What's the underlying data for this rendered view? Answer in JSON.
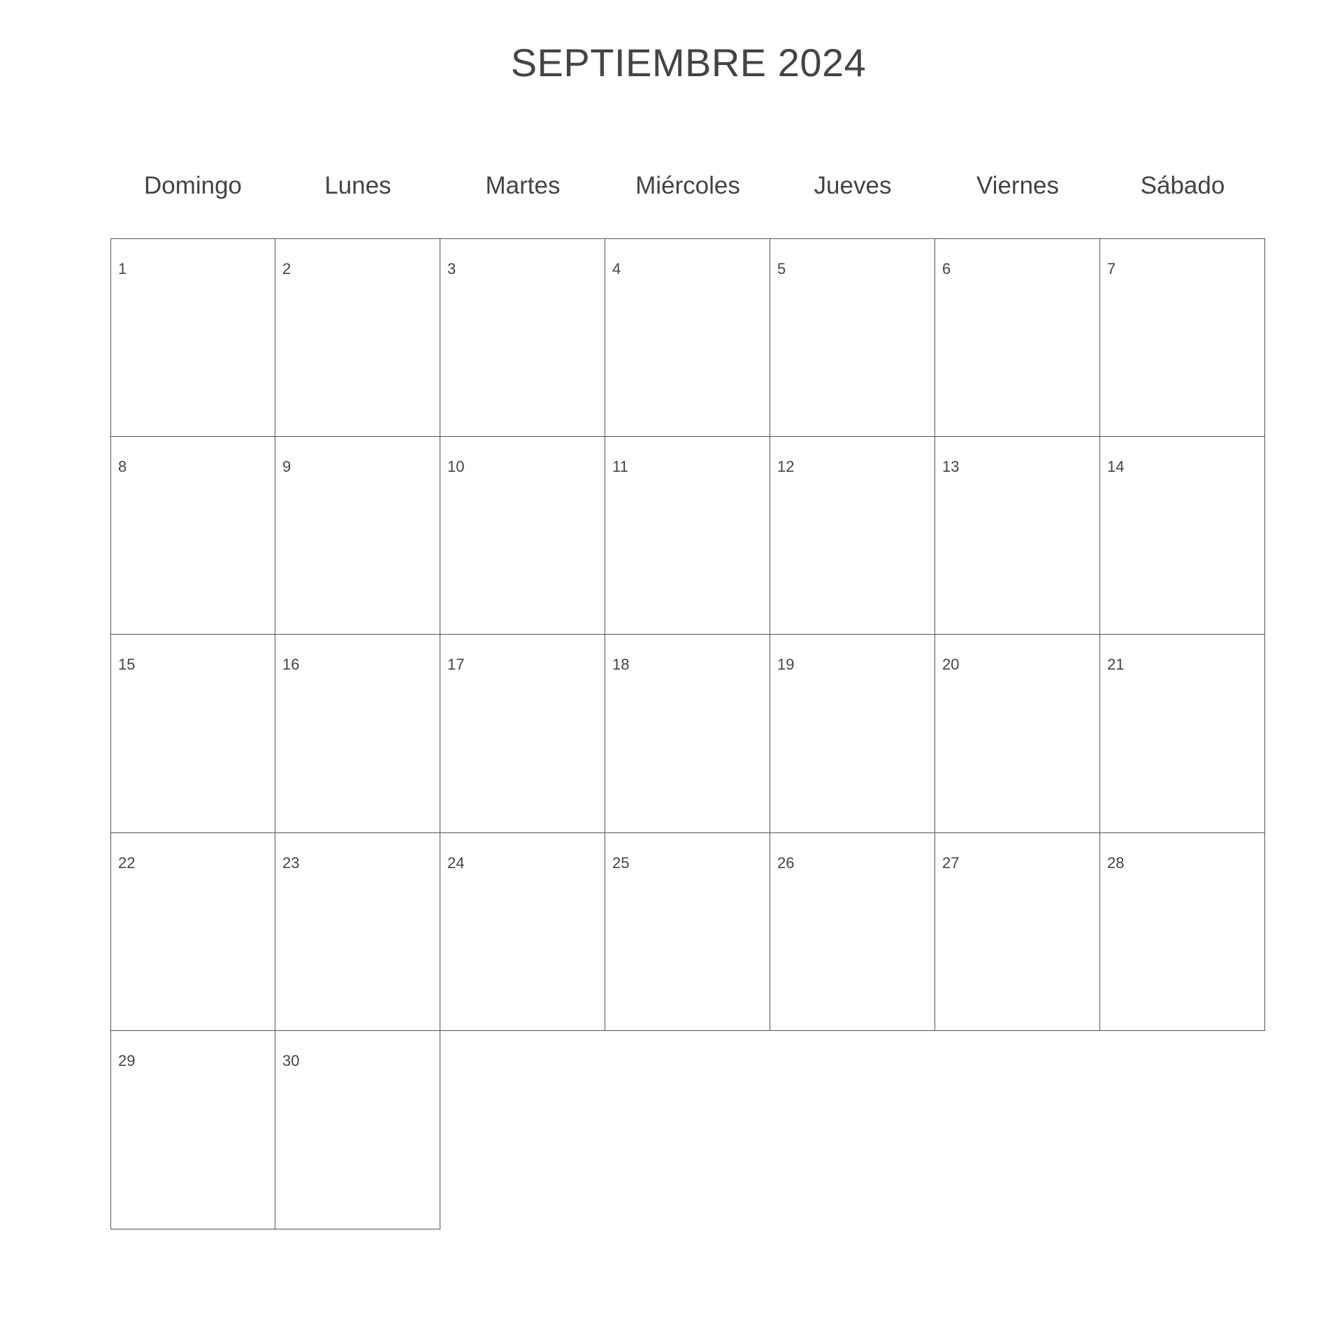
{
  "calendar": {
    "title": "SEPTIEMBRE 2024",
    "weekdays": [
      "Domingo",
      "Lunes",
      "Martes",
      "Miércoles",
      "Jueves",
      "Viernes",
      "Sábado"
    ],
    "first_weekday_index": 0,
    "days_in_month": 30
  }
}
